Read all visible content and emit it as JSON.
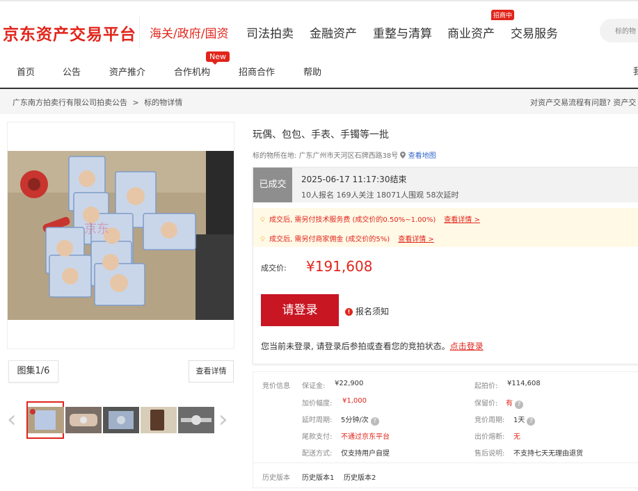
{
  "header": {
    "logo": "京东资产交易平台",
    "nav": [
      "海关/政府/国资",
      "司法拍卖",
      "金融资产",
      "重整与清算",
      "商业资产",
      "交易服务"
    ],
    "recruit_badge": "招商中",
    "search_placeholder": "标的物"
  },
  "subnav": {
    "items": [
      "首页",
      "公告",
      "资产推介",
      "合作机构",
      "招商合作",
      "帮助"
    ],
    "new_badge": "New",
    "right_text": "我"
  },
  "breadcrumb": {
    "parent": "广东南方拍卖行有限公司拍卖公告",
    "sep": ">",
    "current": "标的物详情"
  },
  "help_text": "对资产交易流程有问题? 资产交",
  "gallery": {
    "count": "图集1/6",
    "detail_button": "查看详情",
    "prev_icon": "‹",
    "next_icon": "›"
  },
  "item": {
    "title": "玩偶、包包、手表、手镯等一批",
    "location_label": "标的物所在地:",
    "location": "广东广州市天河区石牌西路38号",
    "map_link": "查看地图"
  },
  "auction": {
    "status": "已成交",
    "end_time": "2025-06-17 11:17:30结束",
    "stats": "10人报名  169人关注  18071人围观  58次延时"
  },
  "notices": [
    {
      "text": "成交后, 需另付技术服务费 (成交价的0.50%~1.00%)",
      "link": "查看详情 >"
    },
    {
      "text": "成交后, 需另付商家佣金 (成交价的5%)",
      "link": "查看详情 >"
    }
  ],
  "deal": {
    "price_label": "成交价:",
    "price": "¥191,608",
    "login_button": "请登录",
    "registration_notice": "报名须知",
    "login_tip": "您当前未登录, 请登录后参拍或查看您的竞拍状态。",
    "login_link": "点击登录"
  },
  "bid_info": {
    "section_label": "竞价信息",
    "deposit_label": "保证金:",
    "deposit": "¥22,900",
    "start_price_label": "起拍价:",
    "start_price": "¥114,608",
    "increment_label": "加价幅度:",
    "increment": "¥1,000",
    "reserve_label": "保留价:",
    "reserve": "有",
    "delay_label": "延时周期:",
    "delay": "5分钟/次",
    "bid_period_label": "竞价周期:",
    "bid_period": "1天",
    "balance_label": "尾款支付:",
    "balance": "不通过京东平台",
    "fuse_label": "出价熔断:",
    "fuse": "无",
    "delivery_label": "配送方式:",
    "delivery": "仅支持用户自提",
    "aftersale_label": "售后说明:",
    "aftersale": "不支持七天无理由退货"
  },
  "history": {
    "label": "历史版本",
    "versions": [
      "历史版本1",
      "历史版本2"
    ]
  },
  "colors": {
    "brand": "#e1251b",
    "button": "#c81623"
  }
}
